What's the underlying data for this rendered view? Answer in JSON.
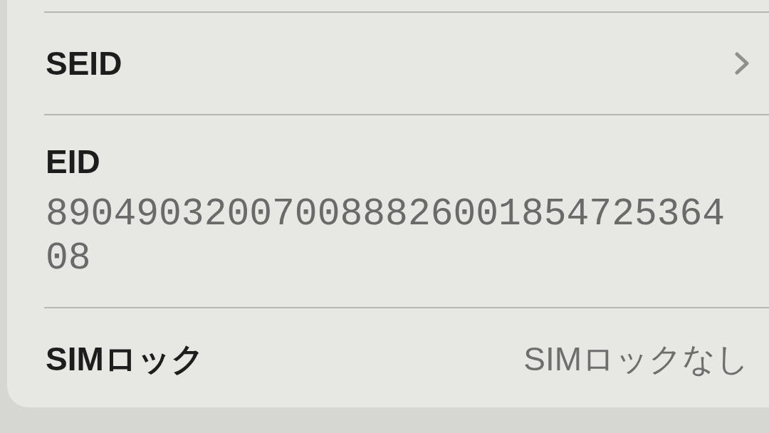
{
  "rows": [
    {
      "kind": "link",
      "label": "SEID"
    },
    {
      "kind": "value_below",
      "label": "EID",
      "value": "89049032007008882600185472536408"
    },
    {
      "kind": "value_right",
      "label": "SIMロック",
      "value": "SIMロックなし"
    }
  ]
}
